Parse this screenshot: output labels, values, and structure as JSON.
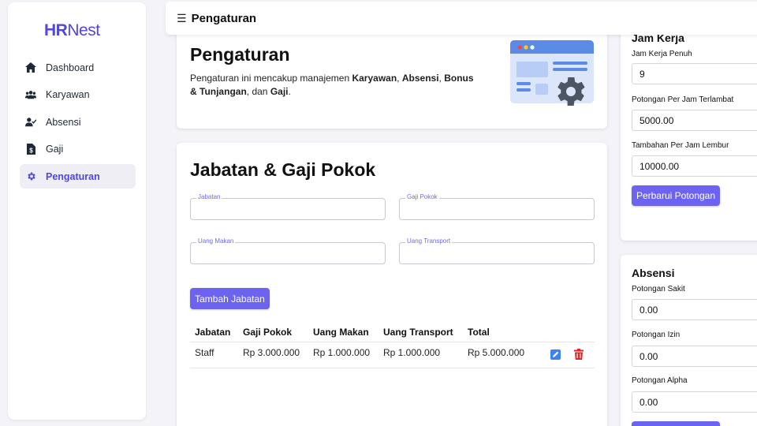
{
  "sidebar": {
    "logo_bold": "HR",
    "logo_light": "Nest",
    "items": [
      {
        "label": "Dashboard",
        "icon": "home-icon"
      },
      {
        "label": "Karyawan",
        "icon": "users-icon"
      },
      {
        "label": "Absensi",
        "icon": "user-check-icon"
      },
      {
        "label": "Gaji",
        "icon": "file-dollar-icon"
      },
      {
        "label": "Pengaturan",
        "icon": "gear-icon",
        "active": true
      }
    ]
  },
  "header": {
    "title": "Pengaturan"
  },
  "intro": {
    "title": "Pengaturan",
    "desc_prefix": "Pengaturan ini mencakup manajemen ",
    "k1": "Karyawan",
    "sep1": ", ",
    "k2": "Absensi",
    "sep2": ", ",
    "k3": "Bonus & Tunjangan",
    "sep3": ", dan ",
    "k4": "Gaji",
    "end": "."
  },
  "jabatan": {
    "title": "Jabatan & Gaji Pokok",
    "fields": {
      "jabatan": {
        "label": "Jabatan",
        "value": ""
      },
      "gaji_pokok": {
        "label": "Gaji Pokok",
        "value": ""
      },
      "uang_makan": {
        "label": "Uang Makan",
        "value": ""
      },
      "uang_transport": {
        "label": "Uang Transport",
        "value": ""
      }
    },
    "add_button": "Tambah Jabatan",
    "table": {
      "headers": [
        "Jabatan",
        "Gaji Pokok",
        "Uang Makan",
        "Uang Transport",
        "Total"
      ],
      "rows": [
        {
          "jabatan": "Staff",
          "gaji_pokok": "Rp 3.000.000",
          "uang_makan": "Rp 1.000.000",
          "uang_transport": "Rp 1.000.000",
          "total": "Rp 5.000.000"
        }
      ]
    }
  },
  "jam_kerja": {
    "title": "Jam Kerja",
    "jam_penuh_label": "Jam Kerja Penuh",
    "jam_penuh_value": "9",
    "potongan_terlambat_label": "Potongan Per Jam Terlambat",
    "potongan_terlambat_value": "5000.00",
    "lembur_label": "Tambahan Per Jam Lembur",
    "lembur_value": "10000.00",
    "update_button": "Perbarui Potongan"
  },
  "absensi": {
    "title": "Absensi",
    "sakit_label": "Potongan Sakit",
    "sakit_value": "0.00",
    "izin_label": "Potongan Izin",
    "izin_value": "0.00",
    "alpha_label": "Potongan Alpha",
    "alpha_value": "0.00"
  },
  "colors": {
    "accent": "#6c63f0",
    "brand": "#4f46e5",
    "edit_icon": "#3b82f6",
    "delete_icon": "#dc2626"
  }
}
